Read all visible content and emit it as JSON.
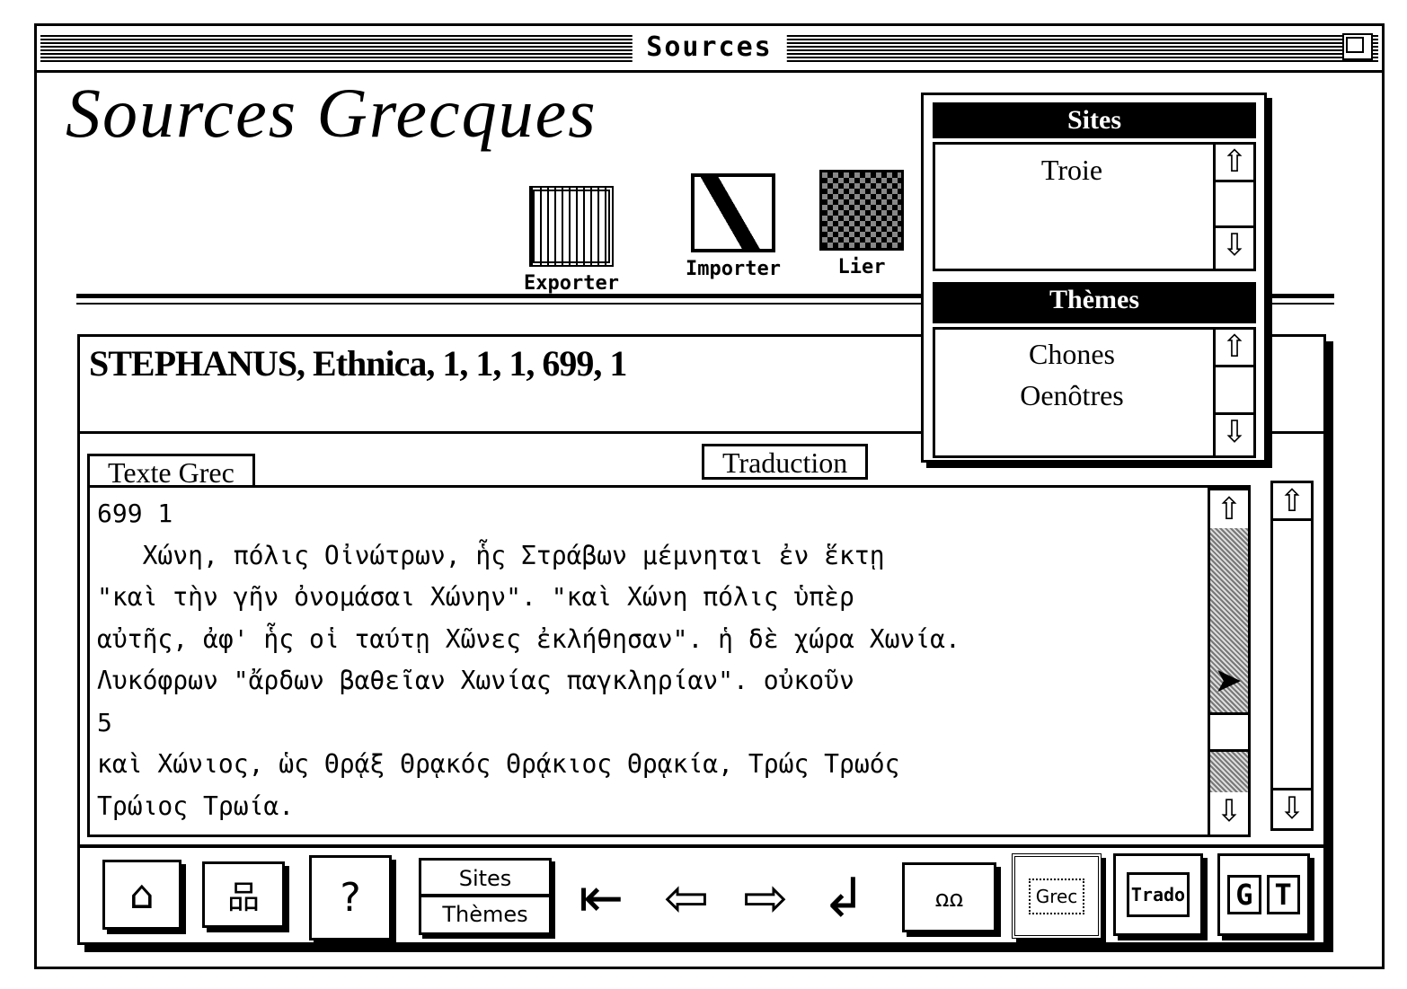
{
  "window": {
    "title": "Sources"
  },
  "app": {
    "title": "Sources Grecques"
  },
  "tools": [
    {
      "label": "Exporter",
      "icon": "export-icon"
    },
    {
      "label": "Importer",
      "icon": "import-icon"
    },
    {
      "label": "Lier",
      "icon": "link-icon"
    }
  ],
  "palette": {
    "sites_header": "Sites",
    "sites": [
      "Troie"
    ],
    "themes_header": "Thèmes",
    "themes": [
      "Chones",
      "Oenôtres"
    ]
  },
  "card": {
    "reference": "STEPHANUS, Ethnica, 1, 1, 1, 699, 1",
    "tab_greek": "Texte Grec",
    "tab_translation": "Traduction",
    "lines": [
      "699 1",
      "   Χώνη, πόλις Οἰνώτρων, ἧς Στράβων μέμνηται ἐν ἕκτῃ",
      "\"καὶ τὴν γῆν ὀνομάσαι Χώνην\". \"καὶ Χώνη πόλις ὑπὲρ",
      "αὐτῆς, ἀφ' ἧς οἱ ταύτῃ Χῶνες ἐκλήθησαν\". ἡ δὲ χώρα Χωνία.",
      "Λυκόφρων \"ἄρδων βαθεῖαν Χωνίας παγκληρίαν\". οὐκοῦν",
      "5",
      "καὶ Χώνιος, ὡς Θρᾴξ Θρᾳκός Θρᾴκιος Θρᾳκία, Τρώς Τρωός",
      "Τρώιος Τρωία."
    ]
  },
  "bottom": {
    "sites": "Sites",
    "themes": "Thèmes",
    "grec": "Grec",
    "trado": "Trado",
    "g": "G",
    "t": "T"
  }
}
